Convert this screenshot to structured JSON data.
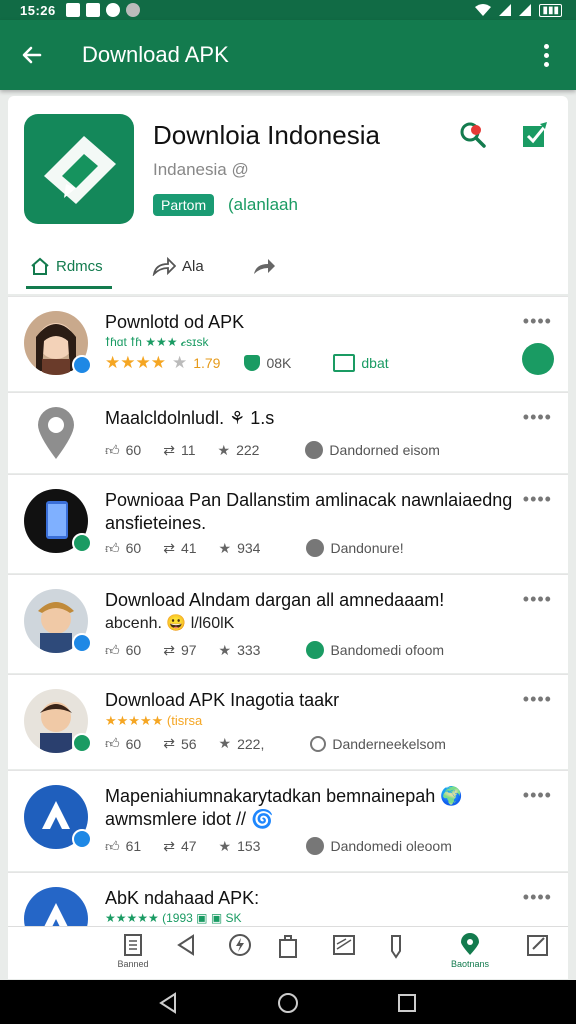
{
  "status": {
    "time": "15:26"
  },
  "appbar": {
    "title": "Download APK"
  },
  "app": {
    "name": "Downloia Indonesia",
    "developer": "Indanesia @",
    "badge": "Partom",
    "badge2": "(alanlaah"
  },
  "tabs": [
    {
      "label": "Rdmcs"
    },
    {
      "label": "Ala"
    }
  ],
  "rows": [
    {
      "title": "Pownlotd od APK",
      "line2": "ꝉɦɑt ꝉɦ ★★★ 𝓬sɪsk",
      "rating": "1.79",
      "downloads": "08K",
      "status": "dbat"
    },
    {
      "title": "Maalcldolnludl. ⚘ 1.s",
      "likes": "60",
      "reposts": "11",
      "stars": "222",
      "status": "Dandorned eisom"
    },
    {
      "title": "Pownioaa Pan Dallanstim amlinacak nawnlaiaedng ansfieteines.",
      "likes": "60",
      "reposts": "41",
      "stars": "934",
      "status": "Dandonure!"
    },
    {
      "title": "Download Alndam dargan all amnedaaam!",
      "line2": "abcenh. 😀 l/l60lK",
      "likes": "60",
      "reposts": "97",
      "stars": "333",
      "status": "Bandomedi ofoom"
    },
    {
      "title": "Download APK Inagotia taakr",
      "line2": "★★★★★ (tisrsa",
      "likes": "60",
      "reposts": "56",
      "stars": "222,",
      "status": "Danderneekelsom"
    },
    {
      "title": "Mapeniahiumnakarytadkan bemnainepah 🌍 awmsmlere idot // 🌀",
      "likes": "61",
      "reposts": "47",
      "stars": "153",
      "status": "Dandomedi oleoom"
    },
    {
      "title": "AbK ndahaad APK:",
      "line2": "★★★★★ (1993 ▣ ▣ SK"
    }
  ],
  "bottomnav": {
    "left_label": "Banned",
    "right_label": "Baotnans"
  },
  "colors": {
    "brand": "#137b4e",
    "accent": "#1a9b63"
  }
}
